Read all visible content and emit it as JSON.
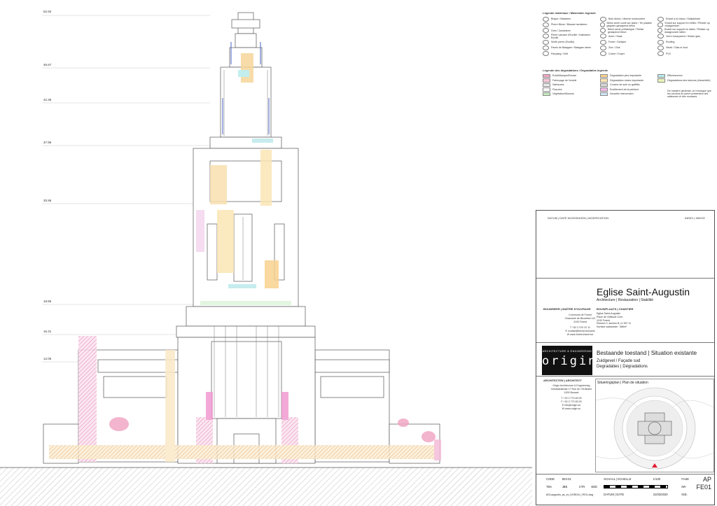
{
  "levels": [
    "52.92",
    "46.67",
    "42.36",
    "37.96",
    "30.96",
    "18.86",
    "16.31",
    "12.06"
  ],
  "legend_materials": {
    "title": "Légende matériaux / Materialen legende",
    "items": [
      "Brique / Baksteen",
      "Pierre Bleue / Blauwe hardsteen",
      "Grès / Zandsteen",
      "Pierre calcaire d'Euville / Kalksteen Euville",
      "Smith pierre (Euville)",
      "Pavés de Balagam / Balagam steen",
      "Parpaing / Gritt",
      "Bois divers / diverse houtsoorten",
      "Béton armé coulé sur place / Ter plaatse gegoten gewapend beton",
      "Béton armé préfabriqué / Prefab gewapend beton",
      "Acier / Staal",
      "Fonte / Gietijzer",
      "Zinc / Zink",
      "Cuivre / Koper",
      "Enduit à la chaux / Kalkpleister",
      "Enduit sur support en treillis / Pleister op draagrooster",
      "Enduit sur support en lattes / Pleister op draagrooster latten",
      "Verre transparent / Helder glas",
      "Roofing",
      "Vitrail / Glas in lood",
      "PVC"
    ]
  },
  "legend_degradations": {
    "title": "Légende des dégradations / Degradaties legende",
    "items": [
      {
        "label": "Eclat/Manque/Ecrasé",
        "color": "#f2a7c5"
      },
      {
        "label": "Faïençage de l'enduit",
        "color": "#f7c6d8"
      },
      {
        "label": "Salissures",
        "color": "#eeeeee"
      },
      {
        "label": "Fissures",
        "color": "#ffffff"
      },
      {
        "label": "Végétation/Mousse",
        "color": "#c7ecc0"
      },
      {
        "label": "Dégradation plus importante",
        "color": "#f9d38f"
      },
      {
        "label": "Dégradation moins importante",
        "color": "#fbe6b5"
      },
      {
        "label": "Couche de suie ou graffitis",
        "color": "#d9d9d9"
      },
      {
        "label": "Ecaillement de la peinture",
        "color": "#f0b9e6"
      },
      {
        "label": "Nouvelle intervention",
        "color": "#cfe7f8"
      },
      {
        "label": "Efflorescence",
        "color": "#b9ecec"
      },
      {
        "label": "Dégradations des balcons (étanchéité)",
        "color": "#e7f5b8"
      }
    ],
    "note": "De manière générale, on remarque que les cordons en pierre présentent des salissures et des mousses."
  },
  "titleblock": {
    "revision_header": "DATUM | DATE     WIJZIGINGEN | MODIFICATION",
    "index_label": "INDEX | INDICE",
    "project_title": "Eglise Saint-Augustin",
    "project_sub": "Architecture | Restauration | Stabilité",
    "owner_label": "BOUWHEER | MAÎTRE D'OUVRAGE",
    "owner_lines": [
      "Commune de Forest",
      "Chaussée de Bruxelles 112",
      "1190 Forest",
      "T +32 2 370 22 11",
      "E contact@forest.brussels",
      "W www.forest.irisnet.be"
    ],
    "site_label": "BOUWPLAATS | CHANTIER",
    "site_lines": [
      "Eglise Saint-Augustin",
      "Place de l'Altitude Cent",
      "1190 Forest",
      "Division 2, section B, nr 357 11",
      "Surface cadastrale : 586m²"
    ],
    "logo_tag": "ARCHITECTURE & ENGINEERING",
    "logo_word": "origin",
    "drawing_title": "Bestaande toestand | Situation existante",
    "drawing_sub1": "Zuidgevel / Façade sud",
    "drawing_sub2": "Degradaties | Dégradations",
    "architect_label": "ARCHITECTEN | ARCHITECT",
    "architect_lines": [
      "Origin Architecture & Engineering",
      "Vorstlaanstraat 17 Rue de l'Ordinaire",
      "1000 Brussel",
      "T +32 2 770 83 00",
      "F +32 2 770 83 00",
      "E info@origin.eu",
      "W www.origin.eu"
    ],
    "situation_label": "Situeringsplan | Plan de situation",
    "code_label": "CODE",
    "code_value": "823-01",
    "schaal_label": "SCHAAL | ECHELLE",
    "schaal_value": "1/100",
    "fase_label": "FASE",
    "fase_value": "AP",
    "tek_label": "TEK",
    "tek_value": "JBE",
    "ctr_label": "CTR",
    "ctr_value": "EDE",
    "datum_label": "DATUM | DATE",
    "datum_value": "31/03/2020",
    "nr_label": "NR",
    "nr_value": "FE01",
    "ind_label": "IND.",
    "file_value": "823-augustin_as_ex_DGRD01_FE01.dwg"
  }
}
